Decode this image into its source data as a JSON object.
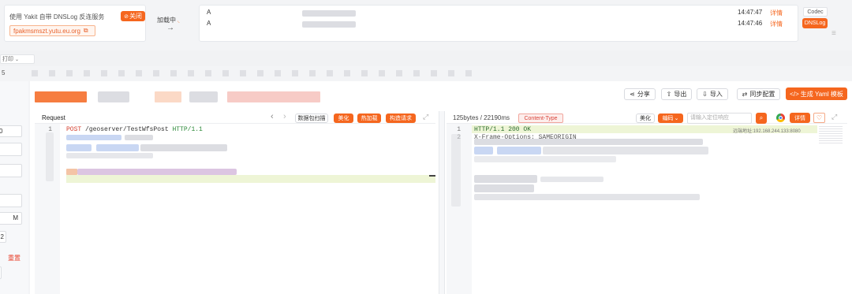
{
  "dnslog": {
    "description": "使用 Yakit 自带 DNSLog 反连服务",
    "close_label": "关闭",
    "domain": "fpakmsmszt.yutu.eu.org",
    "loading_label": "加载中",
    "records": [
      {
        "type": "A",
        "time": "14:47:47",
        "action": "详情"
      },
      {
        "type": "A",
        "time": "14:47:46",
        "action": "详情"
      }
    ],
    "codec_label": "Codec",
    "dnslog_label": "DNSLog"
  },
  "toolbar": {
    "share": "分享",
    "export": "导出",
    "import": "导入",
    "sync": "同步配置",
    "yaml": "生成 Yaml 模板"
  },
  "request": {
    "title": "Request",
    "packet_scan": "数据包扫描",
    "beautify": "美化",
    "hot_load": "热加载",
    "construct": "构造请求",
    "line1_num": "1",
    "line1_method": "POST",
    "line1_path": "/geoserver/TestWfsPost",
    "line1_proto": "HTTP/1.1"
  },
  "response": {
    "stats": "125bytes / 22190ms",
    "content_type": "Content-Type",
    "beautify": "美化",
    "encoding": "编码",
    "search_placeholder": "请输入定位响应",
    "detail": "详情",
    "line1_num": "1",
    "line1_text": "HTTP/1.1 200 OK",
    "line1_addr": "远端地址:192.168.244.133:8080",
    "line2_num": "2",
    "line2_text": "X-Frame-Options: SAMEORIGIN"
  },
  "sidebar": {
    "tab_fragment": "打印",
    "num_top": "5",
    "field1": "0",
    "field5": "M",
    "field6": "2",
    "red_text": "重置"
  },
  "colors": {
    "accent": "#f5661e",
    "highlight_line": "#eef5d6",
    "red": "#e8412c"
  }
}
